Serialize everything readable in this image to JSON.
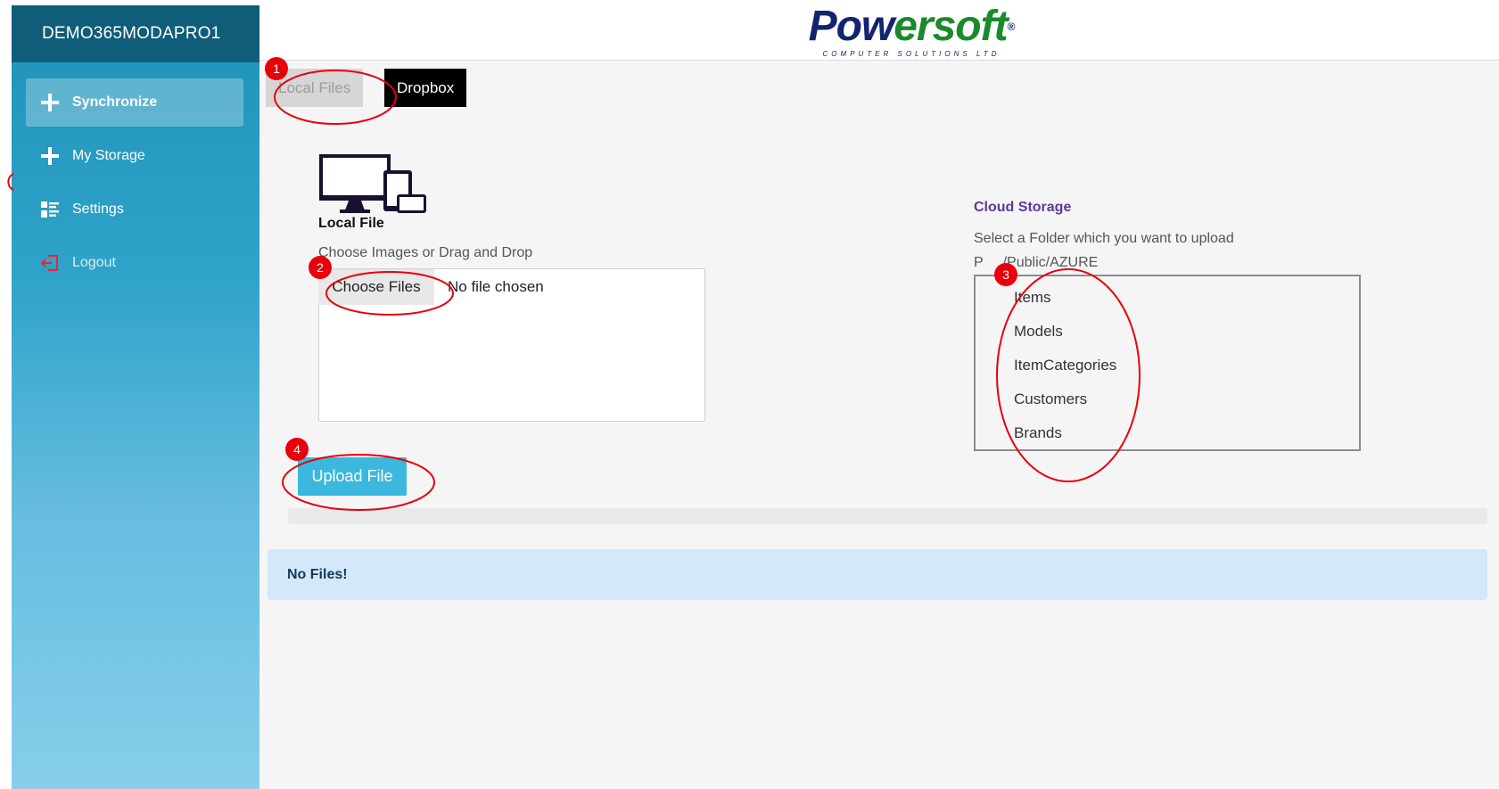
{
  "sidebar": {
    "tenant": "DEMO365MODAPRO1",
    "items": [
      {
        "label": "Synchronize",
        "icon": "plus-icon"
      },
      {
        "label": "My Storage",
        "icon": "plus-icon"
      },
      {
        "label": "Settings",
        "icon": "list-settings-icon"
      },
      {
        "label": "Logout",
        "icon": "logout-icon"
      }
    ]
  },
  "header": {
    "logo_text_left": "Pow",
    "logo_text_right": "ersoft",
    "logo_reg": "®",
    "logo_sub": "COMPUTER SOLUTIONS LTD"
  },
  "tabs": [
    {
      "label": "Local Files"
    },
    {
      "label": "Dropbox"
    }
  ],
  "local": {
    "title": "Local File",
    "hint": "Choose Images or Drag and Drop",
    "choose_button": "Choose Files",
    "no_file": "No file chosen",
    "upload_button": "Upload File"
  },
  "alert": {
    "text": "No Files!"
  },
  "cloud": {
    "title": "Cloud Storage",
    "hint": "Select a Folder which you want to upload",
    "path": "P     /Public/AZURE",
    "folders": [
      "Items",
      "Models",
      "ItemCategories",
      "Customers",
      "Brands"
    ]
  },
  "annotations": {
    "badges": [
      "1",
      "2",
      "3",
      "4"
    ],
    "color": "#e8000b"
  },
  "colors": {
    "sidebar_head": "#0f5d78",
    "accent": "#3ab8dd",
    "dropbox_tab": "#000000",
    "alert_bg": "#d3e8f9",
    "cloud_title": "#5b3a9e"
  }
}
